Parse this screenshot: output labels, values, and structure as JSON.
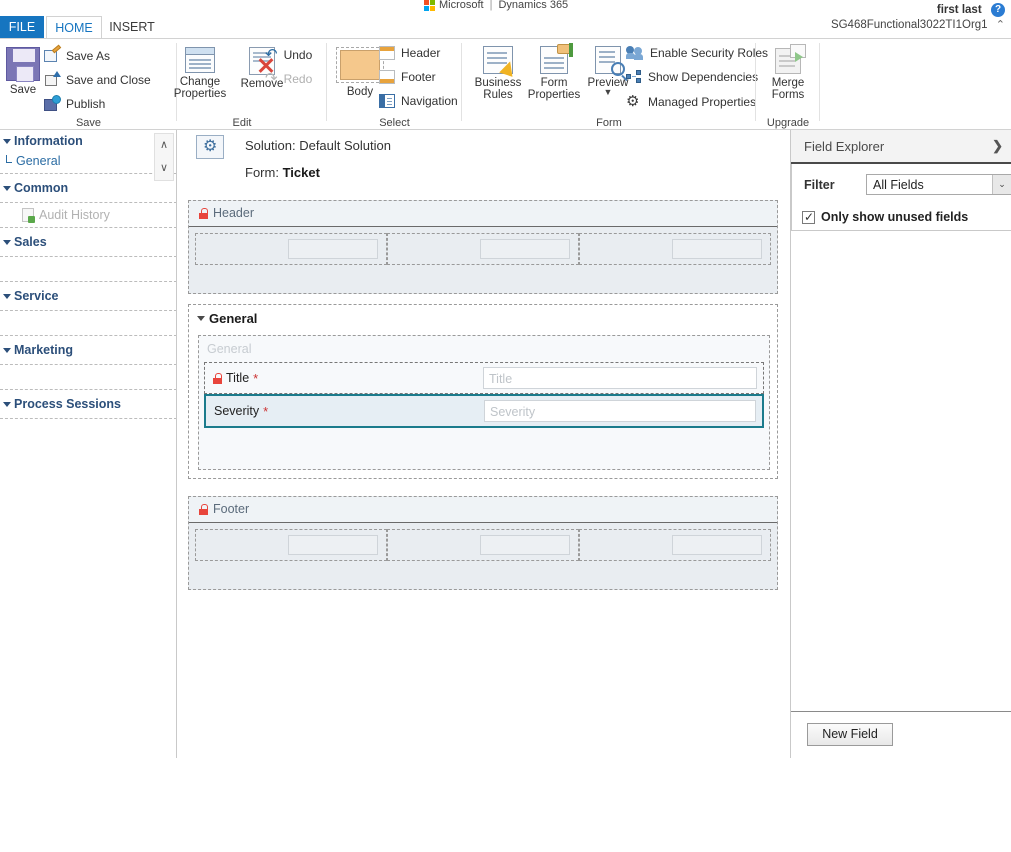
{
  "brand": {
    "logo_icon": "microsoft-logo-icon",
    "company": "Microsoft",
    "separator": "|",
    "product": "Dynamics 365"
  },
  "user": {
    "name": "first last",
    "org": "SG468Functional3022TI1Org1",
    "help_icon": "help-icon",
    "help_glyph": "?",
    "org_chevron_glyph": "⌃"
  },
  "tabs": [
    {
      "id": "file",
      "label": "FILE"
    },
    {
      "id": "home",
      "label": "HOME"
    },
    {
      "id": "insert",
      "label": "INSERT"
    }
  ],
  "ribbon": {
    "groups": [
      {
        "name": "Save",
        "label": "Save",
        "big_buttons": [
          {
            "label": "Save",
            "icon": "floppy-disk-icon"
          }
        ],
        "small_buttons": [
          {
            "label": "Save As",
            "icon": "save-as-icon",
            "disabled": false
          },
          {
            "label": "Save and Close",
            "icon": "save-and-close-icon",
            "disabled": false
          },
          {
            "label": "Publish",
            "icon": "publish-icon",
            "disabled": false
          }
        ]
      },
      {
        "name": "Edit",
        "label": "Edit",
        "big_buttons": [
          {
            "label": "Change Properties",
            "icon": "change-properties-icon"
          },
          {
            "label": "Remove",
            "icon": "remove-icon"
          }
        ],
        "small_buttons": [
          {
            "label": "Undo",
            "icon": "undo-icon",
            "disabled": false
          },
          {
            "label": "Redo",
            "icon": "redo-icon",
            "disabled": true
          }
        ]
      },
      {
        "name": "Select",
        "label": "Select",
        "big_buttons": [
          {
            "label": "Body",
            "icon": "body-icon"
          }
        ],
        "small_buttons": [
          {
            "label": "Header",
            "icon": "header-icon",
            "disabled": false
          },
          {
            "label": "Footer",
            "icon": "footer-icon",
            "disabled": false
          },
          {
            "label": "Navigation",
            "icon": "navigation-icon",
            "disabled": false
          }
        ]
      },
      {
        "name": "Form",
        "label": "Form",
        "big_buttons": [
          {
            "label": "Business Rules",
            "icon": "business-rules-icon"
          },
          {
            "label": "Form Properties",
            "icon": "form-properties-icon"
          },
          {
            "label": "Preview",
            "icon": "preview-icon",
            "has_dropdown": true
          }
        ],
        "small_buttons": [
          {
            "label": "Enable Security Roles",
            "icon": "security-roles-icon",
            "disabled": false
          },
          {
            "label": "Show Dependencies",
            "icon": "show-dependencies-icon",
            "disabled": false
          },
          {
            "label": "Managed Properties",
            "icon": "managed-properties-gear-icon",
            "disabled": false
          }
        ]
      },
      {
        "name": "Upgrade",
        "label": "Upgrade",
        "big_buttons": [
          {
            "label": "Merge Forms",
            "icon": "merge-forms-icon"
          }
        ],
        "small_buttons": []
      }
    ]
  },
  "leftnav": {
    "scroll_up_glyph": "∧",
    "scroll_down_glyph": "∨",
    "groups": [
      {
        "label": "Information",
        "items": [
          {
            "label": "General",
            "type": "link"
          }
        ]
      },
      {
        "label": "Common",
        "items": [
          {
            "label": "Audit History",
            "type": "muted"
          }
        ]
      },
      {
        "label": "Sales",
        "items": []
      },
      {
        "label": "Service",
        "items": []
      },
      {
        "label": "Marketing",
        "items": []
      },
      {
        "label": "Process Sessions",
        "items": []
      }
    ]
  },
  "canvas": {
    "solution_icon": "solution-gear-icon",
    "solution_line": "Solution: Default Solution",
    "form_prefix": "Form: ",
    "form_name": "Ticket",
    "header_section": {
      "title": "Header",
      "lock_icon": "lock-icon",
      "columns": 3
    },
    "general_tab": {
      "title": "General",
      "section_label": "General",
      "fields": [
        {
          "label": "Title",
          "required": true,
          "locked": true,
          "placeholder": "Title",
          "selected": false
        },
        {
          "label": "Severity",
          "required": true,
          "locked": false,
          "placeholder": "Severity",
          "selected": true
        }
      ]
    },
    "footer_section": {
      "title": "Footer",
      "lock_icon": "lock-icon",
      "columns": 3
    }
  },
  "field_explorer": {
    "title": "Field Explorer",
    "collapse_glyph": "❯",
    "filter_label": "Filter",
    "filter_value": "All Fields",
    "filter_options": [
      "All Fields"
    ],
    "dropdown_glyph": "⌄",
    "only_unused_label": "Only show unused fields",
    "only_unused_checked": true,
    "new_field_button": "New Field"
  },
  "colors": {
    "accent_blue": "#1675c0",
    "tab_file_bg": "#1675c0",
    "selected_field_border": "#1b7b8c",
    "required_star": "#cc3333",
    "lock_red": "#e8453c",
    "nav_header": "#2c4f7a"
  }
}
